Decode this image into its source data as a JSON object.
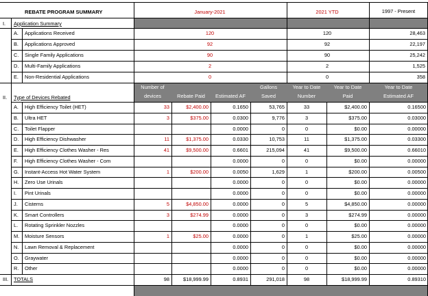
{
  "header": {
    "title": "REBATE PROGRAM SUMMARY",
    "col_month": "January-2021",
    "col_ytd": "2021 YTD",
    "col_total": "1997 - Present"
  },
  "section1": {
    "roman": "I.",
    "title": "Application Summary",
    "rows": [
      {
        "letter": "A.",
        "label": "Applications Received",
        "month": "120",
        "ytd": "120",
        "total": "28,463"
      },
      {
        "letter": "B.",
        "label": "Applications Approved",
        "month": "92",
        "ytd": "92",
        "total": "22,197"
      },
      {
        "letter": "C.",
        "label": "Single Family Applications",
        "month": "90",
        "ytd": "90",
        "total": "25,242"
      },
      {
        "letter": "D.",
        "label": "Multi-Family Applications",
        "month": "2",
        "ytd": "2",
        "total": "1,525"
      },
      {
        "letter": "E.",
        "label": "Non-Residential Applications",
        "month": "0",
        "ytd": "0",
        "total": "358"
      }
    ]
  },
  "section2": {
    "roman": "II.",
    "title": "Type of Devices Rebated",
    "col_headers": {
      "devices_1": "Number of",
      "devices_2": "devices",
      "rebate": "Rebate Paid",
      "af": "Estimated AF",
      "gallons_1": "Gallons",
      "gallons_2": "Saved",
      "ytd_num_1": "Year to Date",
      "ytd_num_2": "Number",
      "ytd_paid_1": "Year to Date",
      "ytd_paid_2": "Paid",
      "ytd_af_1": "Year to Date",
      "ytd_af_2": "Estimated AF"
    },
    "rows": [
      {
        "letter": "A.",
        "label": "High Efficiency Toilet (HET)",
        "devices": "33",
        "rebate": "$2,400.00",
        "af": "0.1650",
        "gallons": "53,765",
        "ytd_num": "33",
        "ytd_paid": "$2,400.00",
        "ytd_af": "0.16500"
      },
      {
        "letter": "B.",
        "label": "Ultra HET",
        "devices": "3",
        "rebate": "$375.00",
        "af": "0.0300",
        "gallons": "9,776",
        "ytd_num": "3",
        "ytd_paid": "$375.00",
        "ytd_af": "0.03000"
      },
      {
        "letter": "C.",
        "label": "Toilet Flapper",
        "devices": "",
        "rebate": "",
        "af": "0.0000",
        "gallons": "0",
        "ytd_num": "0",
        "ytd_paid": "$0.00",
        "ytd_af": "0.00000"
      },
      {
        "letter": "D.",
        "label": "High Efficiency Dishwasher",
        "devices": "11",
        "rebate": "$1,375.00",
        "af": "0.0330",
        "gallons": "10,753",
        "ytd_num": "11",
        "ytd_paid": "$1,375.00",
        "ytd_af": "0.03300"
      },
      {
        "letter": "E.",
        "label": "High Efficiency Clothes Washer - Res",
        "devices": "41",
        "rebate": "$9,500.00",
        "af": "0.6601",
        "gallons": "215,094",
        "ytd_num": "41",
        "ytd_paid": "$9,500.00",
        "ytd_af": "0.66010"
      },
      {
        "letter": "F.",
        "label": "High Efficiency Clothes Washer - Com",
        "devices": "",
        "rebate": "",
        "af": "0.0000",
        "gallons": "0",
        "ytd_num": "0",
        "ytd_paid": "$0.00",
        "ytd_af": "0.00000"
      },
      {
        "letter": "G.",
        "label": "Instant-Access Hot Water System",
        "devices": "1",
        "rebate": "$200.00",
        "af": "0.0050",
        "gallons": "1,629",
        "ytd_num": "1",
        "ytd_paid": "$200.00",
        "ytd_af": "0.00500"
      },
      {
        "letter": "H.",
        "label": "Zero Use Urinals",
        "devices": "",
        "rebate": "",
        "af": "0.0000",
        "gallons": "0",
        "ytd_num": "0",
        "ytd_paid": "$0.00",
        "ytd_af": "0.00000"
      },
      {
        "letter": "I.",
        "label": "Pint Urinals",
        "devices": "",
        "rebate": "",
        "af": "0.0000",
        "gallons": "0",
        "ytd_num": "0",
        "ytd_paid": "$0.00",
        "ytd_af": "0.00000"
      },
      {
        "letter": "J.",
        "label": "Cisterns",
        "devices": "5",
        "rebate": "$4,850.00",
        "af": "0.0000",
        "gallons": "0",
        "ytd_num": "5",
        "ytd_paid": "$4,850.00",
        "ytd_af": "0.00000"
      },
      {
        "letter": "K.",
        "label": "Smart Controllers",
        "devices": "3",
        "rebate": "$274.99",
        "af": "0.0000",
        "gallons": "0",
        "ytd_num": "3",
        "ytd_paid": "$274.99",
        "ytd_af": "0.00000"
      },
      {
        "letter": "L.",
        "label": "Rotating Sprinkler Nozzles",
        "devices": "",
        "rebate": "",
        "af": "0.0000",
        "gallons": "0",
        "ytd_num": "0",
        "ytd_paid": "$0.00",
        "ytd_af": "0.00000"
      },
      {
        "letter": "M.",
        "label": "Moisture Sensors",
        "devices": "1",
        "rebate": "$25.00",
        "af": "0.0000",
        "gallons": "0",
        "ytd_num": "1",
        "ytd_paid": "$25.00",
        "ytd_af": "0.00000"
      },
      {
        "letter": "N.",
        "label": "Lawn Removal & Replacement",
        "devices": "",
        "rebate": "",
        "af": "0.0000",
        "gallons": "0",
        "ytd_num": "0",
        "ytd_paid": "$0.00",
        "ytd_af": "0.00000"
      },
      {
        "letter": "O.",
        "label": "Graywater",
        "devices": "",
        "rebate": "",
        "af": "0.0000",
        "gallons": "0",
        "ytd_num": "0",
        "ytd_paid": "$0.00",
        "ytd_af": "0.00000"
      },
      {
        "letter": "R.",
        "label": "Other",
        "devices": "",
        "rebate": "",
        "af": "0.0000",
        "gallons": "0",
        "ytd_num": "0",
        "ytd_paid": "$0.00",
        "ytd_af": "0.00000"
      }
    ]
  },
  "totals": {
    "roman": "III.",
    "label": "TOTALS",
    "devices": "98",
    "rebate": "$18,999.99",
    "af": "0.8931",
    "gallons": "291,018",
    "ytd_num": "98",
    "ytd_paid": "$18,999.99",
    "ytd_af": "0.89310"
  },
  "colors": {
    "red_text": "#c00000",
    "gray_fill": "#808080",
    "header_text_light": "#ffffff"
  }
}
